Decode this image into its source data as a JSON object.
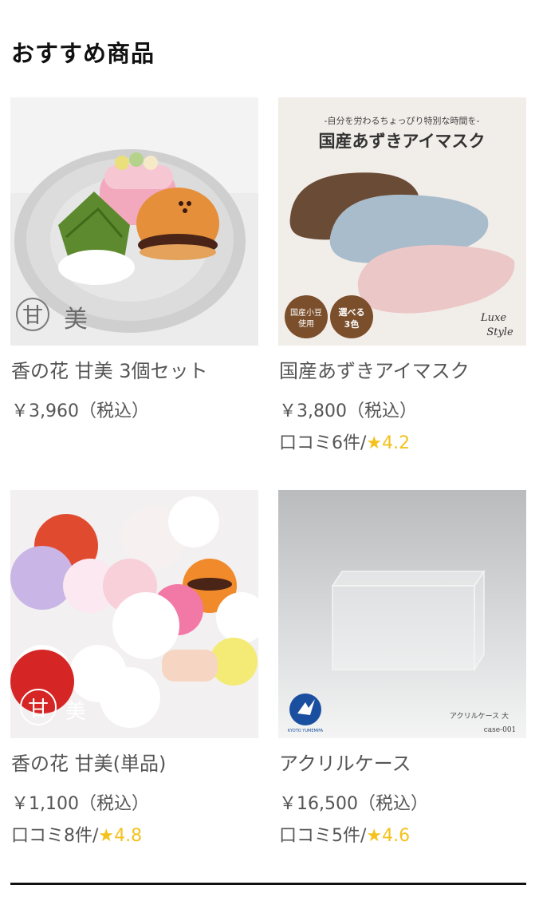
{
  "section": {
    "title": "おすすめ商品"
  },
  "products": [
    {
      "name": "香の花 甘美 3個セット",
      "price": "￥3,960（税込）",
      "image_logo": "甘美"
    },
    {
      "name": "国産あずきアイマスク",
      "price": "￥3,800（税込）",
      "review_label": "口コミ6件/",
      "rating": "4.2",
      "image_banner_sub": "-自分を労わるちょっぴり特別な時間を-",
      "image_banner_title": "国産あずきアイマスク",
      "image_badge_1": "国産小豆使用",
      "image_badge_2": "選べる3色",
      "image_signature": "Luxe Style"
    },
    {
      "name": "香の花 甘美(単品)",
      "price": "￥1,100（税込）",
      "review_label": "口コミ8件/",
      "rating": "4.8",
      "image_logo": "甘美"
    },
    {
      "name": "アクリルケース",
      "price": "￥16,500（税込）",
      "review_label": "口コミ5件/",
      "rating": "4.6",
      "image_caption_1": "アクリルケース 大",
      "image_caption_2": "case-001",
      "image_brand": "KYOTO YUMEMIFA"
    }
  ],
  "colors": {
    "rating_star": "#f3c21c",
    "text": "#555555",
    "title": "#111111"
  },
  "icons": {
    "star": "star-icon"
  }
}
